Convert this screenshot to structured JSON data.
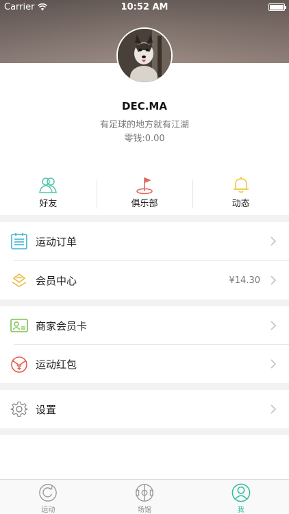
{
  "status_bar": {
    "carrier": "Carrier",
    "time": "10:52 AM"
  },
  "profile": {
    "name": "DEC.MA",
    "motto": "有足球的地方就有江湖",
    "balance_label": "零钱:",
    "balance_value": "0.00"
  },
  "quick_actions": [
    {
      "label": "好友",
      "icon": "friends-icon",
      "color": "#53c7b0"
    },
    {
      "label": "俱乐部",
      "icon": "flag-icon",
      "color": "#e06b5e"
    },
    {
      "label": "动态",
      "icon": "bell-icon",
      "color": "#f2c53d"
    }
  ],
  "menu": {
    "orders": {
      "label": "运动订单",
      "icon": "order-list-icon",
      "color": "#3fb2d8"
    },
    "membership": {
      "label": "会员中心",
      "value": "¥14.30",
      "icon": "member-center-icon",
      "color": "#f0b63c"
    },
    "merchant_card": {
      "label": "商家会员卡",
      "icon": "member-card-icon",
      "color": "#7cc24e"
    },
    "red_packet": {
      "label": "运动红包",
      "icon": "red-packet-icon",
      "color": "#e25b4a"
    },
    "settings": {
      "label": "设置",
      "icon": "gear-icon",
      "color": "#888888"
    }
  },
  "tab_bar": {
    "tabs": [
      {
        "label": "运动",
        "icon": "sport-refresh-icon",
        "active": false
      },
      {
        "label": "场馆",
        "icon": "stadium-icon",
        "active": false
      },
      {
        "label": "我",
        "icon": "profile-icon",
        "active": true
      }
    ],
    "active_color": "#2bbf9a"
  }
}
